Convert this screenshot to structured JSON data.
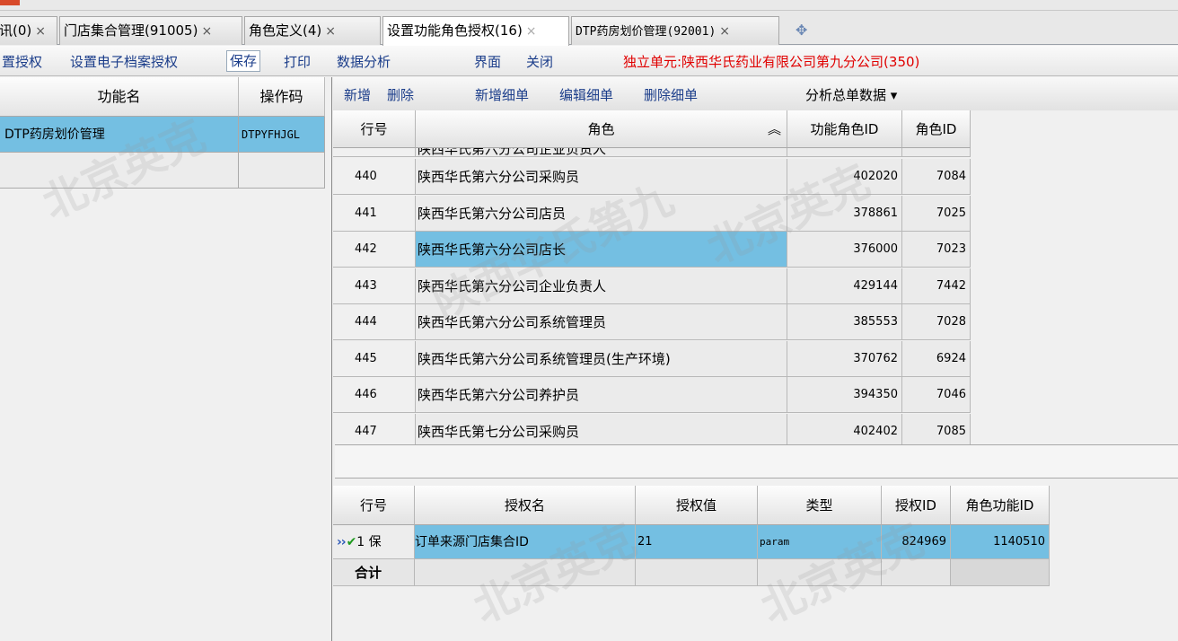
{
  "tabs": [
    {
      "label": "讯(0)",
      "close": "×"
    },
    {
      "label": "门店集合管理(91005)",
      "close": "×"
    },
    {
      "label": "角色定义(4)",
      "close": "×"
    },
    {
      "label": "设置功能角色授权(16)",
      "close": "×"
    },
    {
      "label": "DTP药房划价管理(92001)",
      "close": "×"
    }
  ],
  "toolbar": {
    "items": [
      "置授权",
      "设置电子档案授权",
      "保存",
      "打印",
      "数据分析",
      "界面",
      "关闭"
    ],
    "unit": "独立单元:陕西华氏药业有限公司第九分公司(350)"
  },
  "left_grid": {
    "headers": [
      "功能名",
      "操作码"
    ],
    "rows": [
      {
        "name": "DTP药房划价管理",
        "code": "DTPYFHJGL"
      }
    ]
  },
  "right_toolbar": {
    "items": [
      "新增",
      "删除",
      "新增细单",
      "编辑细单",
      "删除细单"
    ],
    "analysis": "分析总单数据",
    "analysis_arrow": "▾"
  },
  "role_grid": {
    "headers": [
      "行号",
      "角色",
      "功能角色ID",
      "角色ID"
    ],
    "sort_icon": "︽",
    "partial_row": "陕西华氏第六分公司企业负责人",
    "rows": [
      {
        "line": "440",
        "role": "陕西华氏第六分公司采购员",
        "func_role_id": "402020",
        "role_id": "7084"
      },
      {
        "line": "441",
        "role": "陕西华氏第六分公司店员",
        "func_role_id": "378861",
        "role_id": "7025"
      },
      {
        "line": "442",
        "role": "陕西华氏第六分公司店长",
        "func_role_id": "376000",
        "role_id": "7023"
      },
      {
        "line": "443",
        "role": "陕西华氏第六分公司企业负责人",
        "func_role_id": "429144",
        "role_id": "7442"
      },
      {
        "line": "444",
        "role": "陕西华氏第六分公司系统管理员",
        "func_role_id": "385553",
        "role_id": "7028"
      },
      {
        "line": "445",
        "role": "陕西华氏第六分公司系统管理员(生产环境)",
        "func_role_id": "370762",
        "role_id": "6924"
      },
      {
        "line": "446",
        "role": "陕西华氏第六分公司养护员",
        "func_role_id": "394350",
        "role_id": "7046"
      },
      {
        "line": "447",
        "role": "陕西华氏第七分公司采购员",
        "func_role_id": "402402",
        "role_id": "7085"
      }
    ]
  },
  "auth_grid": {
    "headers": [
      "行号",
      "授权名",
      "授权值",
      "类型",
      "授权ID",
      "角色功能ID"
    ],
    "rows": [
      {
        "line": "1 保",
        "name": "订单来源门店集合ID",
        "value": "21",
        "type": "param",
        "auth_id": "824969",
        "role_func_id": "1140510"
      }
    ],
    "total_label": "合计"
  },
  "watermarks": [
    "北京英克",
    "陕西华氏第九"
  ]
}
